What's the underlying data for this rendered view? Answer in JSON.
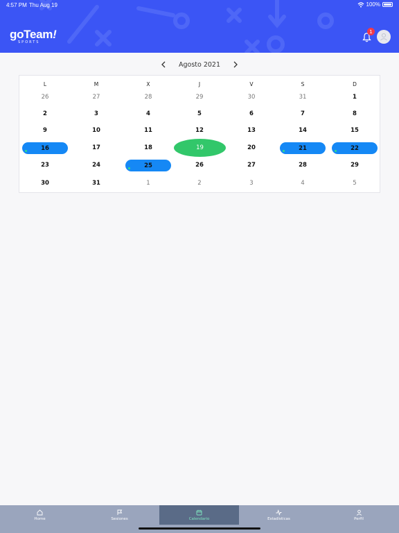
{
  "status_bar": {
    "time": "4:57 PM",
    "date": "Thu Aug 19",
    "battery": "100%"
  },
  "header": {
    "logo_main": "goTeam",
    "logo_mark": "!",
    "logo_sub": "SPORTS",
    "notifications_count": "1",
    "colors": {
      "background": "#3b55f5",
      "badge": "#f03a4a"
    }
  },
  "calendar": {
    "month_label": "Agosto 2021",
    "weekdays": [
      "L",
      "M",
      "X",
      "J",
      "V",
      "S",
      "D"
    ],
    "weeks": [
      [
        {
          "d": "26",
          "t": "other"
        },
        {
          "d": "27",
          "t": "other"
        },
        {
          "d": "28",
          "t": "other"
        },
        {
          "d": "29",
          "t": "other"
        },
        {
          "d": "30",
          "t": "other"
        },
        {
          "d": "31",
          "t": "other"
        },
        {
          "d": "1",
          "t": "current"
        }
      ],
      [
        {
          "d": "2",
          "t": "current"
        },
        {
          "d": "3",
          "t": "current"
        },
        {
          "d": "4",
          "t": "current"
        },
        {
          "d": "5",
          "t": "current"
        },
        {
          "d": "6",
          "t": "current"
        },
        {
          "d": "7",
          "t": "current"
        },
        {
          "d": "8",
          "t": "current"
        }
      ],
      [
        {
          "d": "9",
          "t": "current"
        },
        {
          "d": "10",
          "t": "current"
        },
        {
          "d": "11",
          "t": "current"
        },
        {
          "d": "12",
          "t": "current"
        },
        {
          "d": "13",
          "t": "current"
        },
        {
          "d": "14",
          "t": "current"
        },
        {
          "d": "15",
          "t": "current"
        }
      ],
      [
        {
          "d": "16",
          "t": "event"
        },
        {
          "d": "17",
          "t": "current"
        },
        {
          "d": "18",
          "t": "current"
        },
        {
          "d": "19",
          "t": "today"
        },
        {
          "d": "20",
          "t": "current"
        },
        {
          "d": "21",
          "t": "event"
        },
        {
          "d": "22",
          "t": "event"
        }
      ],
      [
        {
          "d": "23",
          "t": "current"
        },
        {
          "d": "24",
          "t": "current"
        },
        {
          "d": "25",
          "t": "event"
        },
        {
          "d": "26",
          "t": "current"
        },
        {
          "d": "27",
          "t": "current"
        },
        {
          "d": "28",
          "t": "current"
        },
        {
          "d": "29",
          "t": "current"
        }
      ],
      [
        {
          "d": "30",
          "t": "current"
        },
        {
          "d": "31",
          "t": "current"
        },
        {
          "d": "1",
          "t": "other"
        },
        {
          "d": "2",
          "t": "other"
        },
        {
          "d": "3",
          "t": "other"
        },
        {
          "d": "4",
          "t": "other"
        },
        {
          "d": "5",
          "t": "other"
        }
      ]
    ],
    "colors": {
      "event": "#1588f5",
      "today": "#32c76a",
      "event_dot": "#2ee08a"
    }
  },
  "tabbar": {
    "tabs": [
      {
        "label": "Home",
        "icon": "home-icon",
        "active": false
      },
      {
        "label": "Sesiones",
        "icon": "flag-icon",
        "active": false
      },
      {
        "label": "Calendario",
        "icon": "calendar-icon",
        "active": true
      },
      {
        "label": "Estadísticas",
        "icon": "activity-icon",
        "active": false
      },
      {
        "label": "Perfil",
        "icon": "user-icon",
        "active": false
      }
    ],
    "colors": {
      "background": "#9aa5bd",
      "active_background": "#5a6b87",
      "active_text": "#7fe6c0"
    }
  }
}
